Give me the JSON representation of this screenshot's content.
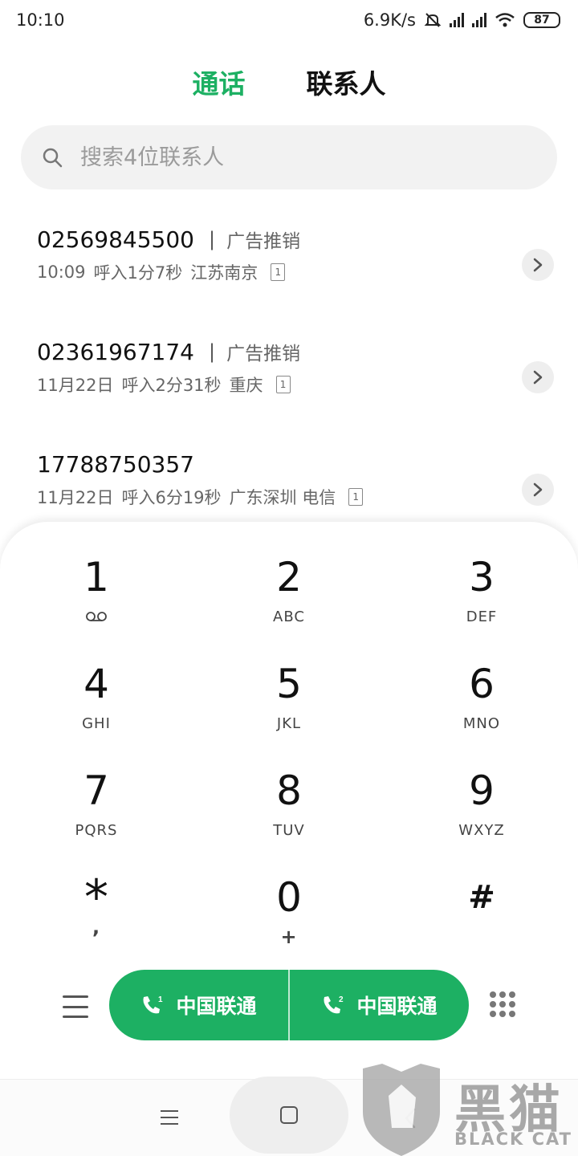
{
  "status_bar": {
    "time": "10:10",
    "net_speed": "6.9K/s",
    "battery": "87"
  },
  "tabs": [
    {
      "label": "通话",
      "active": true
    },
    {
      "label": "联系人",
      "active": false
    }
  ],
  "search": {
    "placeholder": "搜索4位联系人"
  },
  "call_log": [
    {
      "number": "02569845500",
      "tag": "广告推销",
      "time": "10:09",
      "type": "呼入",
      "duration": "1分7秒",
      "location": "江苏南京",
      "sim": "1"
    },
    {
      "number": "02361967174",
      "tag": "广告推销",
      "time": "11月22日",
      "type": "呼入",
      "duration": "2分31秒",
      "location": "重庆",
      "sim": "1"
    },
    {
      "number": "17788750357",
      "tag": "",
      "time": "11月22日",
      "type": "呼入",
      "duration": "6分19秒",
      "location": "广东深圳 电信",
      "sim": "1"
    }
  ],
  "dialpad": {
    "keys": [
      {
        "digit": "1",
        "letters": ""
      },
      {
        "digit": "2",
        "letters": "ABC"
      },
      {
        "digit": "3",
        "letters": "DEF"
      },
      {
        "digit": "4",
        "letters": "GHI"
      },
      {
        "digit": "5",
        "letters": "JKL"
      },
      {
        "digit": "6",
        "letters": "MNO"
      },
      {
        "digit": "7",
        "letters": "PQRS"
      },
      {
        "digit": "8",
        "letters": "TUV"
      },
      {
        "digit": "9",
        "letters": "WXYZ"
      },
      {
        "digit": "*",
        "letters": ","
      },
      {
        "digit": "0",
        "letters": "+"
      },
      {
        "digit": "#",
        "letters": ""
      }
    ]
  },
  "call_buttons": [
    {
      "sim": "1",
      "label": "中国联通"
    },
    {
      "sim": "2",
      "label": "中国联通"
    }
  ],
  "watermark": {
    "title": "黑猫",
    "subtitle": "BLACK CAT"
  },
  "colors": {
    "accent": "#1db063"
  }
}
